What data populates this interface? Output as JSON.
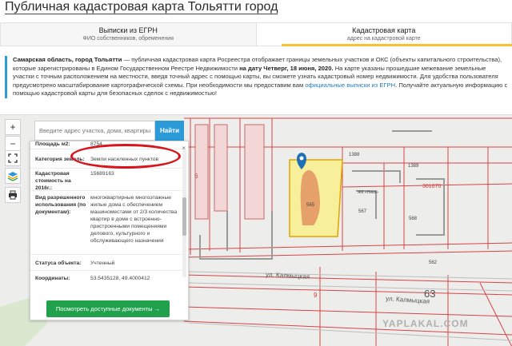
{
  "page": {
    "title": "Публичная кадастровая карта Тольятти город"
  },
  "tabs": [
    {
      "label": "Выписки из ЕГРН",
      "sub": "ФИО собственников, обременения"
    },
    {
      "label": "Кадастровая карта",
      "sub": "адрес на кадастровой карте"
    }
  ],
  "description": {
    "lead": "Самарская область, город Тольятти",
    "p1": " — публичная кадастровая карта Росреестра отображает границы земельных участков и ОКС (объекты капитального строительства), которые зарегистрированы в Едином Государственном Реестре Недвижимости ",
    "date": "на дату Четверг, 18 июня, 2020.",
    "p2": " На карте указаны прошедшие межевание земельные участки с точным расположением на местности, введя точный адрес с помощью карты, вы сможете узнать кадастровый номер недвижимости. Для удобства пользователя предусмотрено масштабирование картографической схемы. При необходимости мы предоставим вам ",
    "link": "официальные выписки из ЕГРН",
    "p3": ". Получайте актуальную информацию с помощью кадастровой карты для безопасных сделок с недвижимостью!"
  },
  "search": {
    "placeholder": "Введите адрес участка, дома, квартиры",
    "button": "Найти"
  },
  "controls": {
    "zoom_in": "+",
    "zoom_out": "−"
  },
  "info": {
    "close": "×",
    "rows": [
      {
        "key": "Площадь м2:",
        "value": "8754"
      },
      {
        "key": "Категория земель:",
        "value": "Земли населенных пунктов"
      },
      {
        "key": "Кадастровая стоимость на 2016г.:",
        "value": "15689163"
      },
      {
        "key": "Вид разрешенного использования (по документам):",
        "value": "многоквартирные многоэтажные жилые дома с обеспечением машиноместами от 2/3 количества квартир в доме с встроенно-пристроенными помещениями делового, культурного и обслуживающего назначения"
      },
      {
        "key": "Статуса объекта:",
        "value": "Учтенный"
      },
      {
        "key": "Координаты:",
        "value": "53.5435128, 49.4000412"
      }
    ],
    "docs_button": "Посмотреть доступные документы →"
  },
  "map": {
    "labels": {
      "l1388": "1388",
      "l1389": "1389",
      "l301070": "301070",
      "l565": "565",
      "l567": "567",
      "l568": "568",
      "l562": "562",
      "l63": "63",
      "l9": "9",
      "l6": "6",
      "jk": "ЖК «Ника»",
      "street1": "ул. Калмыцкая",
      "street2": "ул. Калмыцкая"
    },
    "colors": {
      "parcel_highlight": "#f7ef9a",
      "parcel_stroke": "#e0a400",
      "building": "#e6a06a",
      "boundary": "#d64545"
    }
  },
  "watermark": "YAPLAKAL.COM"
}
